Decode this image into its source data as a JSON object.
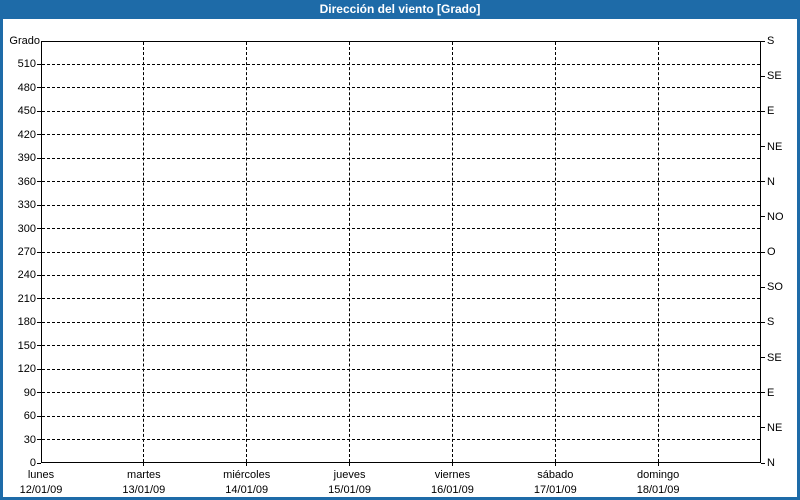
{
  "window": {
    "title": "Dirección del viento [Grado]"
  },
  "colors": {
    "chrome": "#1e6ba8",
    "title_text": "#ffffff",
    "background": "#ffffff",
    "axis": "#000000",
    "grid": "#000000",
    "text": "#000000"
  },
  "chart_data": {
    "type": "line",
    "title": "Dirección del viento [Grado]",
    "grid": true,
    "legend": false,
    "series": [],
    "y_axis_left": {
      "label": "Grado",
      "min": 0,
      "max": 540,
      "tick_interval": 30,
      "ticks": [
        510,
        480,
        450,
        420,
        390,
        360,
        330,
        300,
        270,
        240,
        210,
        180,
        150,
        120,
        90,
        60,
        30,
        0
      ]
    },
    "y_axis_right": {
      "tick_interval_degrees": 45,
      "labels_top_to_bottom": [
        "S",
        "SE",
        "E",
        "NE",
        "N",
        "NO",
        "O",
        "SO",
        "S",
        "SE",
        "E",
        "NE",
        "N"
      ]
    },
    "x_axis": {
      "days": [
        {
          "name": "lunes",
          "date": "12/01/09"
        },
        {
          "name": "martes",
          "date": "13/01/09"
        },
        {
          "name": "miércoles",
          "date": "14/01/09"
        },
        {
          "name": "jueves",
          "date": "15/01/09"
        },
        {
          "name": "viernes",
          "date": "16/01/09"
        },
        {
          "name": "sábado",
          "date": "17/01/09"
        },
        {
          "name": "domingo",
          "date": "18/01/09"
        }
      ]
    }
  }
}
